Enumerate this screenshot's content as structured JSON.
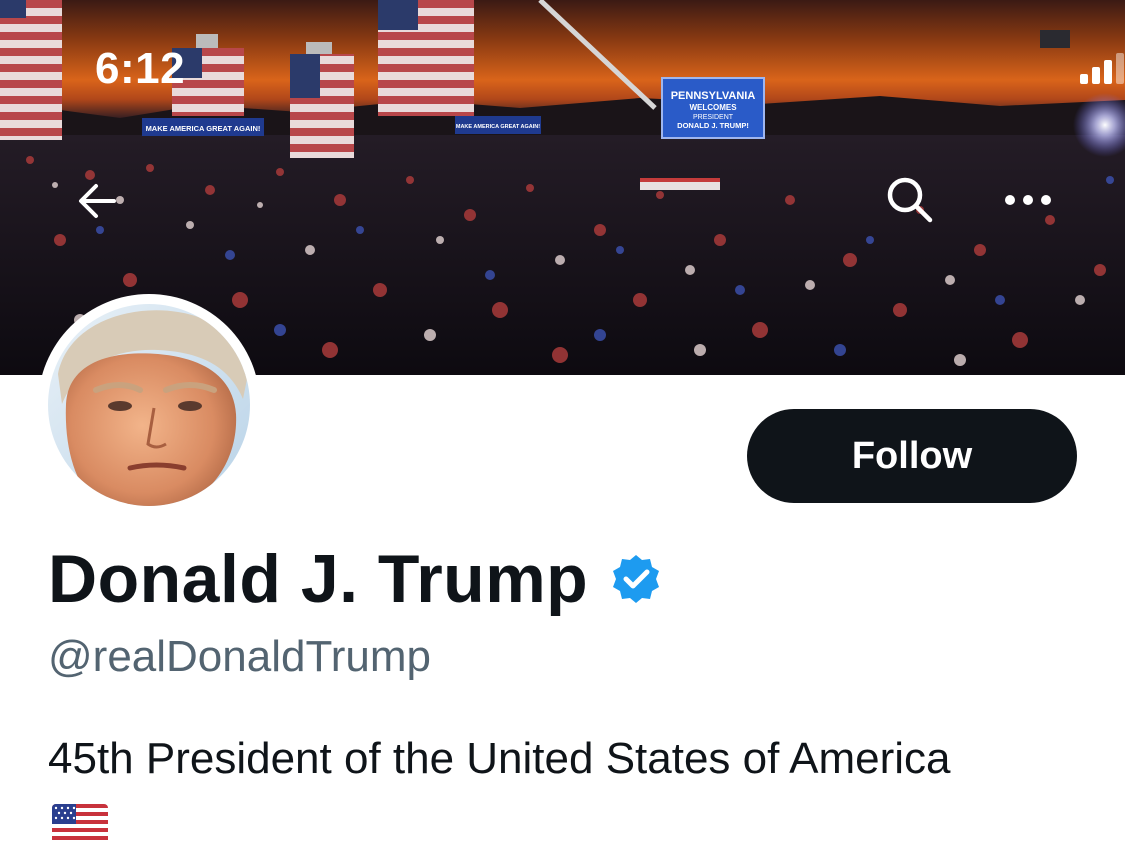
{
  "status_bar": {
    "time": "6:12"
  },
  "banner": {
    "signs": {
      "pennsylvania_line1": "PENNSYLVANIA",
      "pennsylvania_line2": "WELCOMES",
      "pennsylvania_line3": "PRESIDENT",
      "pennsylvania_line4": "DONALD J. TRUMP!",
      "maga_left": "MAKE AMERICA GREAT AGAIN!",
      "maga_right": "MAKE AMERICA GREAT AGAIN!"
    }
  },
  "nav": {
    "icons": [
      "back-arrow-icon",
      "search-icon",
      "more-icon"
    ]
  },
  "profile": {
    "follow_label": "Follow",
    "display_name": "Donald J. Trump",
    "handle": "@realDonaldTrump",
    "bio": "45th President of the United States of America",
    "verified": true
  },
  "colors": {
    "text_primary": "#0f1419",
    "text_secondary": "#536471",
    "verified_blue": "#1d9bf0",
    "button_bg": "#0f1419"
  }
}
